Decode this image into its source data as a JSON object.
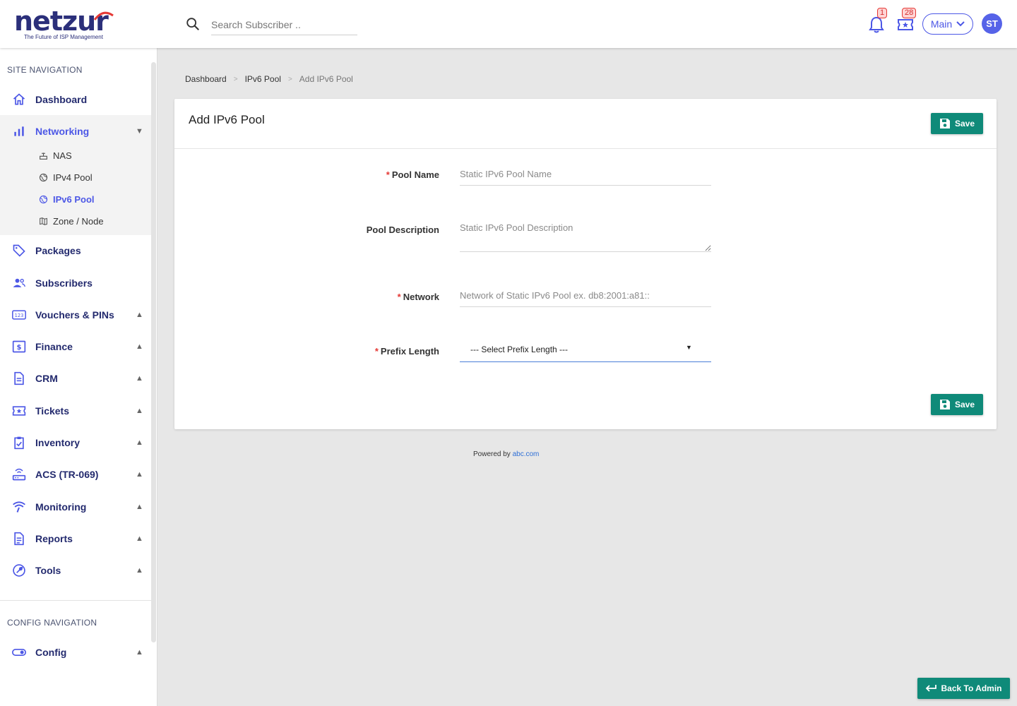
{
  "header": {
    "logo_text": "netzur",
    "logo_tagline": "The Future of ISP Management",
    "search_placeholder": "Search Subscriber ..",
    "notifications_count": "1",
    "tickets_count": "28",
    "branch_label": "Main",
    "avatar_initials": "ST"
  },
  "sidebar": {
    "section_site": "SITE NAVIGATION",
    "section_config": "CONFIG NAVIGATION",
    "items": [
      {
        "label": "Dashboard",
        "icon": "home-icon"
      },
      {
        "label": "Networking",
        "icon": "bar-chart-icon",
        "expanded": true
      },
      {
        "label": "Packages",
        "icon": "tag-icon"
      },
      {
        "label": "Subscribers",
        "icon": "users-icon"
      },
      {
        "label": "Vouchers & PINs",
        "icon": "pin-123-icon"
      },
      {
        "label": "Finance",
        "icon": "dollar-icon"
      },
      {
        "label": "CRM",
        "icon": "document-icon"
      },
      {
        "label": "Tickets",
        "icon": "ticket-icon"
      },
      {
        "label": "Inventory",
        "icon": "clipboard-check-icon"
      },
      {
        "label": "ACS (TR-069)",
        "icon": "router-icon"
      },
      {
        "label": "Monitoring",
        "icon": "signal-icon"
      },
      {
        "label": "Reports",
        "icon": "report-icon"
      },
      {
        "label": "Tools",
        "icon": "wrench-icon"
      },
      {
        "label": "Config",
        "icon": "toggle-icon"
      }
    ],
    "networking_sub": [
      {
        "label": "NAS",
        "icon": "network-icon"
      },
      {
        "label": "IPv4 Pool",
        "icon": "globe-icon"
      },
      {
        "label": "IPv6 Pool",
        "icon": "globe-icon",
        "active": true
      },
      {
        "label": "Zone / Node",
        "icon": "map-icon"
      }
    ]
  },
  "breadcrumb": {
    "items": [
      "Dashboard",
      "IPv6 Pool"
    ],
    "separator": ">",
    "current": "Add IPv6 Pool"
  },
  "form": {
    "title": "Add IPv6 Pool",
    "save_label": "Save",
    "fields": {
      "pool_name": {
        "label": "Pool Name",
        "required": "*",
        "placeholder": "Static IPv6 Pool Name"
      },
      "pool_description": {
        "label": "Pool Description",
        "placeholder": "Static IPv6 Pool Description"
      },
      "network": {
        "label": "Network",
        "required": "*",
        "placeholder": "Network of Static IPv6 Pool ex. db8:2001:a81::"
      },
      "prefix_length": {
        "label": "Prefix Length",
        "required": "*",
        "selected": "--- Select Prefix Length ---"
      }
    }
  },
  "footer": {
    "powered_by": "Powered by",
    "link": "abc.com"
  },
  "back_to_admin": "Back To Admin",
  "colors": {
    "brand_navy": "#232a6e",
    "accent_blue": "#4c57e6",
    "save_green": "#0f8a79",
    "required_red": "#e53935"
  }
}
